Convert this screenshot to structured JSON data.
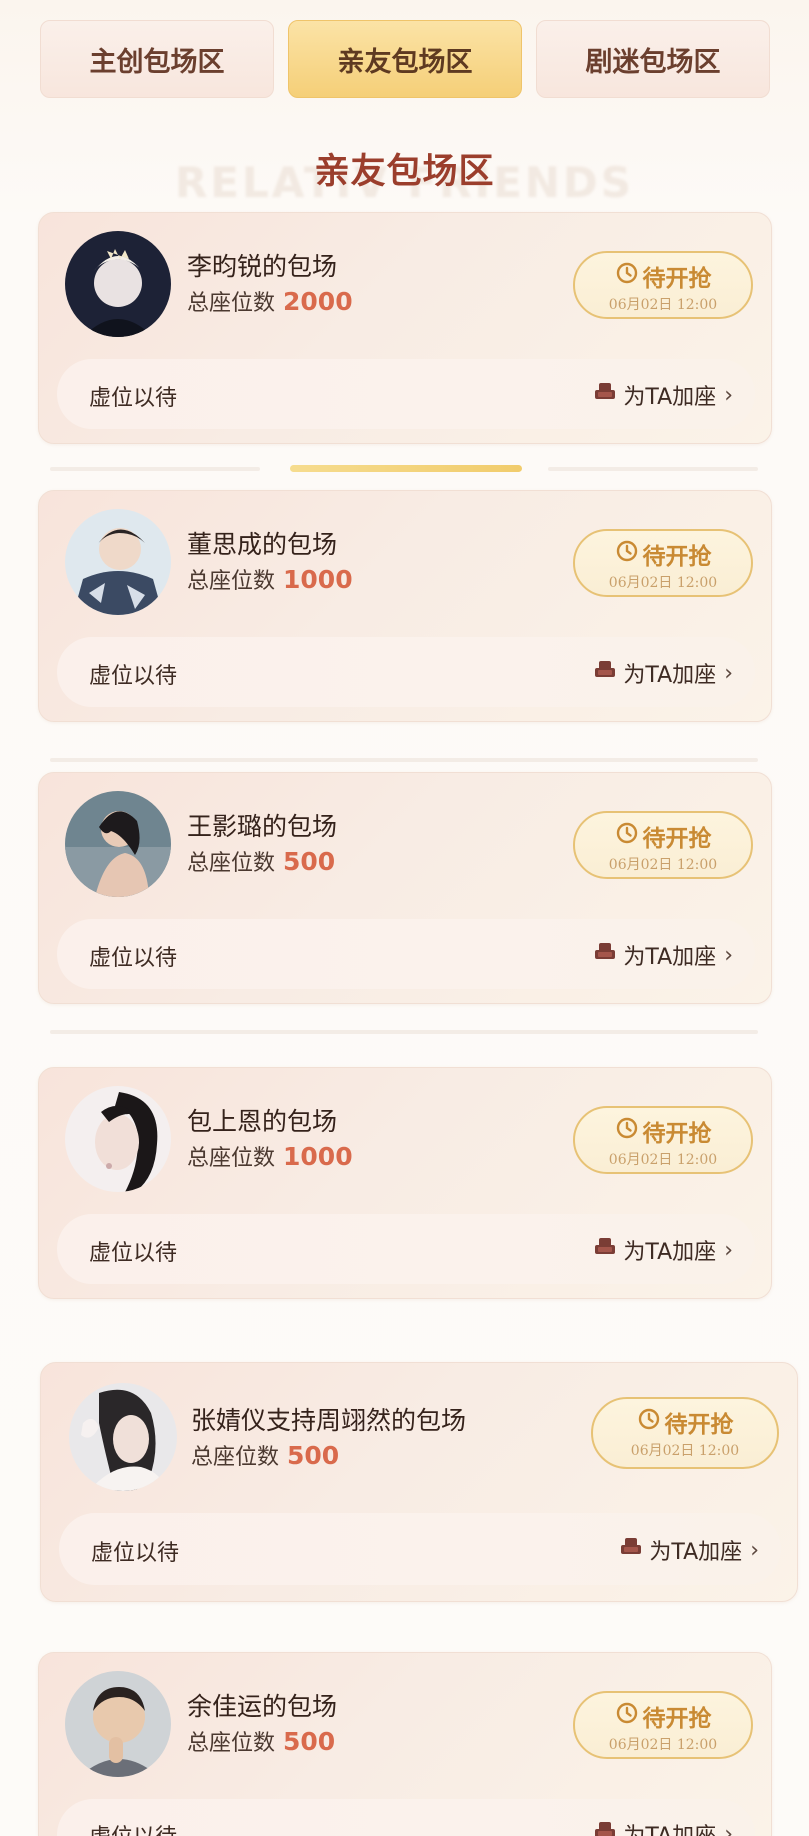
{
  "tabs": [
    {
      "label": "主创包场区",
      "active": false
    },
    {
      "label": "亲友包场区",
      "active": true
    },
    {
      "label": "剧迷包场区",
      "active": false
    }
  ],
  "section": {
    "title": "亲友包场区",
    "watermark": "RELATIV FRIENDS"
  },
  "common": {
    "seats_label": "总座位数",
    "status_label": "待开抢",
    "status_time": "06月02日 12:00",
    "left_text": "虚位以待",
    "add_seat_label": "为TA加座"
  },
  "cards": [
    {
      "name": "李昀锐的包场",
      "seats": "2000"
    },
    {
      "name": "董思成的包场",
      "seats": "1000"
    },
    {
      "name": "王影璐的包场",
      "seats": "500"
    },
    {
      "name": "包上恩的包场",
      "seats": "1000"
    },
    {
      "name": "张婧仪支持周翊然的包场",
      "seats": "500"
    },
    {
      "name": "余佳运的包场",
      "seats": "500"
    }
  ],
  "colors": {
    "accent_gold": "#f5cf78",
    "seat_number": "#d96a4c",
    "title": "#9b3e2c"
  },
  "icons": {
    "status": "clock-icon",
    "add_seat": "seat-icon",
    "more": "chevron-right-icon"
  }
}
